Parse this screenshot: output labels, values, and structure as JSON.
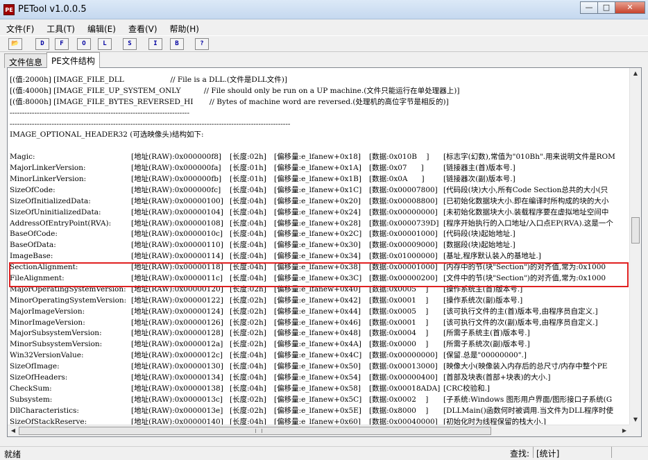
{
  "window": {
    "title": "PETool v1.0.0.5",
    "icon_text": "PE",
    "minimize": "—",
    "maximize": "□",
    "close": "✕"
  },
  "menu": [
    "文件(F)",
    "工具(T)",
    "编辑(E)",
    "查看(V)",
    "帮助(H)"
  ],
  "toolbar": [
    {
      "label": "📂",
      "name": "open-folder-icon"
    },
    {
      "label": "D",
      "name": "toolbar-d-button"
    },
    {
      "label": "F",
      "name": "toolbar-f-button"
    },
    {
      "label": "O",
      "name": "toolbar-o-button"
    },
    {
      "label": "L",
      "name": "toolbar-l-button"
    },
    {
      "label": "S",
      "name": "toolbar-s-button"
    },
    {
      "label": "I",
      "name": "toolbar-i-button"
    },
    {
      "label": "B",
      "name": "toolbar-b-button"
    },
    {
      "label": "?",
      "name": "help-button"
    }
  ],
  "tabs": [
    "文件信息",
    "PE文件结构"
  ],
  "active_tab": 1,
  "pre_lines": [
    "[(值:2000h] [IMAGE_FILE_DLL                    // File is a DLL.(文件是DLL文件)]",
    "[(值:4000h] [IMAGE_FILE_UP_SYSTEM_ONLY          // File should only be run on a UP machine.(文件只能运行在单处理器上)]",
    "[(值:8000h] [IMAGE_FILE_BYTES_REVERSED_HI       // Bytes of machine word are reversed.(处理机的高位字节是相反的)]",
    "-------------------------------------------------------------------------",
    "------------------------------------------------------------------------------------------------------------------",
    "IMAGE_OPTIONAL_HEADER32 (可选映像头)结构如下:",
    ""
  ],
  "rows": [
    [
      "Magic:",
      "[地址(RAW):0x000000f8]",
      "[长度:02h]",
      "[偏移量:e_lfanew+0x18]",
      "[数据:0x010B    ]",
      "[标志字(幻数),常值为\"010Bh\".用来说明文件是ROM"
    ],
    [
      "MajorLinkerVersion:",
      "[地址(RAW):0x000000fa]",
      "[长度:01h]",
      "[偏移量:e_lfanew+0x1A]",
      "[数据:0x07      ]",
      "[链接器主(首)版本号.]"
    ],
    [
      "MinorLinkerVersion:",
      "[地址(RAW):0x000000fb]",
      "[长度:01h]",
      "[偏移量:e_lfanew+0x1B]",
      "[数据:0x0A      ]",
      "[链接器次(副)版本号.]"
    ],
    [
      "SizeOfCode:",
      "[地址(RAW):0x000000fc]",
      "[长度:04h]",
      "[偏移量:e_lfanew+0x1C]",
      "[数据:0x00007800]",
      "[代码段(块)大小,所有Code Section总共的大小(只"
    ],
    [
      "SizeOfInitializedData:",
      "[地址(RAW):0x00000100]",
      "[长度:04h]",
      "[偏移量:e_lfanew+0x20]",
      "[数据:0x00008800]",
      "[已初始化数据块大小.即在编译时所构成的块的大小"
    ],
    [
      "SizeOfUninitializedData:",
      "[地址(RAW):0x00000104]",
      "[长度:04h]",
      "[偏移量:e_lfanew+0x24]",
      "[数据:0x00000000]",
      "[未初始化数据块大小.装载程序要在虚拟地址空间中"
    ],
    [
      "AddressOfEntryPoint(RVA):",
      "[地址(RAW):0x00000108]",
      "[长度:04h]",
      "[偏移量:e_lfanew+0x28]",
      "[数据:0x0000739D]",
      "[程序开始执行的入口地址/入口点EP(RVA).这是一个"
    ],
    [
      "BaseOfCode:",
      "[地址(RAW):0x0000010c]",
      "[长度:04h]",
      "[偏移量:e_lfanew+0x2C]",
      "[数据:0x00001000]",
      "[代码段(块)起始地址.]"
    ],
    [
      "BaseOfData:",
      "[地址(RAW):0x00000110]",
      "[长度:04h]",
      "[偏移量:e_lfanew+0x30]",
      "[数据:0x00009000]",
      "[数据段(块)起始地址.]"
    ],
    [
      "ImageBase:",
      "[地址(RAW):0x00000114]",
      "[长度:04h]",
      "[偏移量:e_lfanew+0x34]",
      "[数据:0x01000000]",
      "[基址,程序默认装入的基地址.]"
    ],
    [
      "SectionAlignment:",
      "[地址(RAW):0x00000118]",
      "[长度:04h]",
      "[偏移量:e_lfanew+0x38]",
      "[数据:0x00001000]",
      "[内存中的节(块\"Section\")的对齐值,常为:0x1000"
    ],
    [
      "FileAlignment:",
      "[地址(RAW):0x0000011c]",
      "[长度:04h]",
      "[偏移量:e_lfanew+0x3C]",
      "[数据:0x00000200]",
      "[文件中的节(块\"Section\")的对齐值,常为:0x1000"
    ],
    [
      "MajorOperatingSystemVersion:",
      "[地址(RAW):0x00000120]",
      "[长度:02h]",
      "[偏移量:e_lfanew+0x40]",
      "[数据:0x0005    ]",
      "[操作系统主(首)版本号.]"
    ],
    [
      "MinorOperatingSystemVersion:",
      "[地址(RAW):0x00000122]",
      "[长度:02h]",
      "[偏移量:e_lfanew+0x42]",
      "[数据:0x0001    ]",
      "[操作系统次(副)版本号.]"
    ],
    [
      "MajorImageVersion:",
      "[地址(RAW):0x00000124]",
      "[长度:02h]",
      "[偏移量:e_lfanew+0x44]",
      "[数据:0x0005    ]",
      "[该可执行文件的主(首)版本号,由程序员自定义.]"
    ],
    [
      "MinorImageVersion:",
      "[地址(RAW):0x00000126]",
      "[长度:02h]",
      "[偏移量:e_lfanew+0x46]",
      "[数据:0x0001    ]",
      "[该可执行文件的次(副)版本号,由程序员自定义.]"
    ],
    [
      "MajorSubsystemVersion:",
      "[地址(RAW):0x00000128]",
      "[长度:02h]",
      "[偏移量:e_lfanew+0x48]",
      "[数据:0x0004    ]",
      "[所需子系统主(首)版本号.]"
    ],
    [
      "MinorSubsystemVersion:",
      "[地址(RAW):0x0000012a]",
      "[长度:02h]",
      "[偏移量:e_lfanew+0x4A]",
      "[数据:0x0000    ]",
      "[所需子系统次(副)版本号.]"
    ],
    [
      "Win32VersionValue:",
      "[地址(RAW):0x0000012c]",
      "[长度:04h]",
      "[偏移量:e_lfanew+0x4C]",
      "[数据:0x00000000]",
      "[保留.总是\"00000000\".]"
    ],
    [
      "SizeOfImage:",
      "[地址(RAW):0x00000130]",
      "[长度:04h]",
      "[偏移量:e_lfanew+0x50]",
      "[数据:0x00013000]",
      "[映像大小(映像装入内存后的总尺寸/内存中整个PE"
    ],
    [
      "SizeOfHeaders:",
      "[地址(RAW):0x00000134]",
      "[长度:04h]",
      "[偏移量:e_lfanew+0x54]",
      "[数据:0x00000400]",
      "[首部及块表(首部+块表)的大小.]"
    ],
    [
      "CheckSum:",
      "[地址(RAW):0x00000138]",
      "[长度:04h]",
      "[偏移量:e_lfanew+0x58]",
      "[数据:0x00018ADA]",
      "[CRC校验和.]"
    ],
    [
      "Subsystem:",
      "[地址(RAW):0x0000013c]",
      "[长度:02h]",
      "[偏移量:e_lfanew+0x5C]",
      "[数据:0x0002    ]",
      "[子系统:Windows 图形用户界面/图形接口子系统(G"
    ],
    [
      "DllCharacteristics:",
      "[地址(RAW):0x0000013e]",
      "[长度:02h]",
      "[偏移量:e_lfanew+0x5E]",
      "[数据:0x8000    ]",
      "[DLLMain()函数何时被调用.当文件为DLL程序时使"
    ],
    [
      "SizeOfStackReserve:",
      "[地址(RAW):0x00000140]",
      "[长度:04h]",
      "[偏移量:e_lfanew+0x60]",
      "[数据:0x00040000]",
      "[初始化时为线程保留的栈大小.]"
    ]
  ],
  "highlighted_rows": [
    "SectionAlignment:",
    "FileAlignment:"
  ],
  "status": {
    "left": "就绪",
    "search_label": "查找:",
    "search_value": "[统计]"
  }
}
